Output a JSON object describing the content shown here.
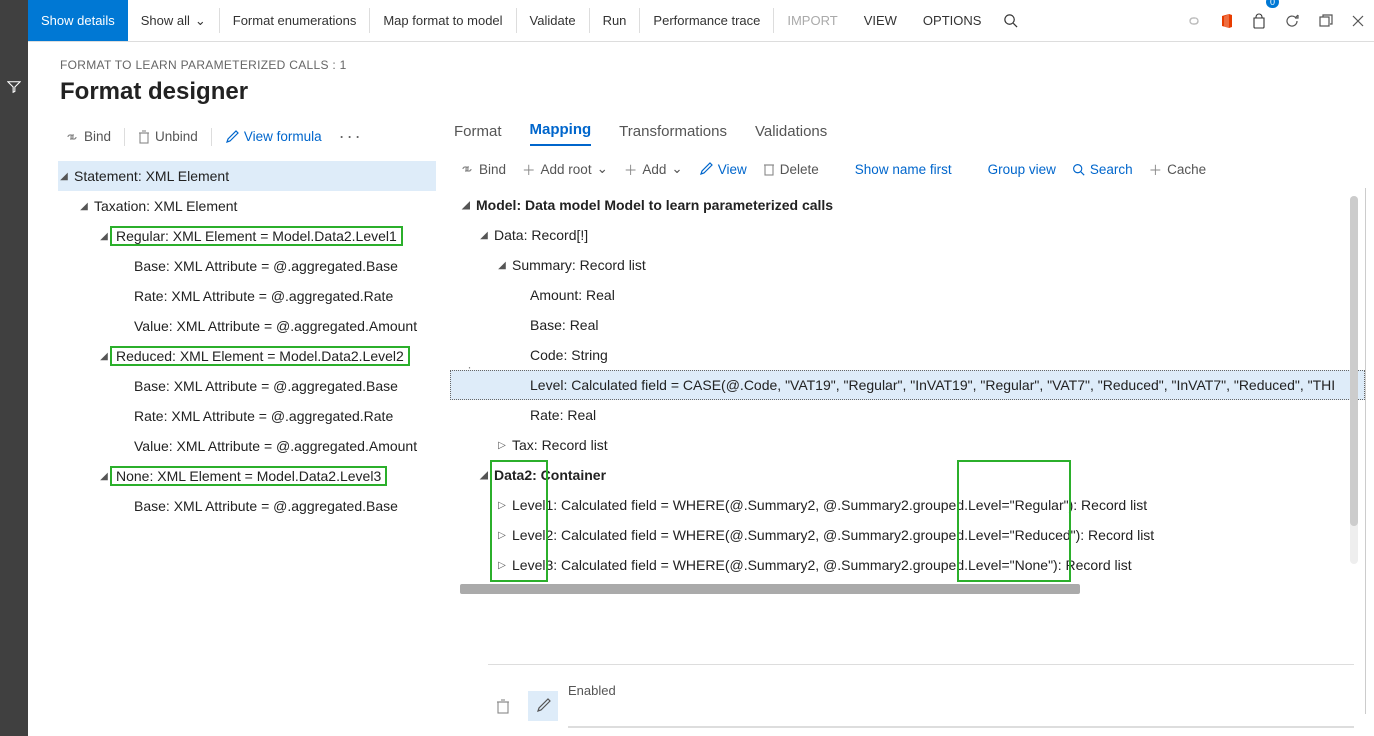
{
  "toolbar": {
    "show_details": "Show details",
    "show_all": "Show all",
    "format_enum": "Format enumerations",
    "map_format": "Map format to model",
    "validate": "Validate",
    "run": "Run",
    "perf": "Performance trace",
    "import": "IMPORT",
    "view": "VIEW",
    "options": "OPTIONS",
    "badge": "0"
  },
  "header": {
    "crumb": "FORMAT TO LEARN PARAMETERIZED CALLS : 1",
    "title": "Format designer"
  },
  "actions": {
    "bind": "Bind",
    "unbind": "Unbind",
    "view_formula": "View formula"
  },
  "tabs": {
    "format": "Format",
    "mapping": "Mapping",
    "trans": "Transformations",
    "valid": "Validations"
  },
  "rt_actions": {
    "bind": "Bind",
    "add_root": "Add root",
    "add": "Add",
    "view": "View",
    "delete": "Delete",
    "show_name": "Show name first",
    "group": "Group view",
    "search": "Search",
    "cache": "Cache"
  },
  "left_tree": {
    "r0": "Statement: XML Element",
    "r1": "Taxation: XML Element",
    "r2": "Regular: XML Element = Model.Data2.Level1",
    "r3": "Base: XML Attribute = @.aggregated.Base",
    "r4": "Rate: XML Attribute = @.aggregated.Rate",
    "r5": "Value: XML Attribute = @.aggregated.Amount",
    "r6": "Reduced: XML Element = Model.Data2.Level2",
    "r7": "Base: XML Attribute = @.aggregated.Base",
    "r8": "Rate: XML Attribute = @.aggregated.Rate",
    "r9": "Value: XML Attribute = @.aggregated.Amount",
    "r10": "None: XML Element = Model.Data2.Level3",
    "r11": "Base: XML Attribute = @.aggregated.Base"
  },
  "right_tree": {
    "r0": "Model: Data model Model to learn parameterized calls",
    "r1": "Data: Record[!]",
    "r2": "Summary: Record list",
    "r3": "Amount: Real",
    "r4": "Base: Real",
    "r5": "Code: String",
    "r6": "Level: Calculated field = CASE(@.Code, \"VAT19\", \"Regular\", \"InVAT19\", \"Regular\", \"VAT7\", \"Reduced\", \"InVAT7\", \"Reduced\", \"THI",
    "r7": "Rate: Real",
    "r8": "Tax: Record list",
    "r9": "Data2: Container",
    "r10": "Level1: Calculated field = WHERE(@.Summary2, @.Summary2.grouped.Level=\"Regular\"): Record list",
    "r11": "Level2: Calculated field = WHERE(@.Summary2, @.Summary2.grouped.Level=\"Reduced\"): Record list",
    "r12": "Level3: Calculated field = WHERE(@.Summary2, @.Summary2.grouped.Level=\"None\"): Record list"
  },
  "bottom": {
    "enabled": "Enabled"
  }
}
